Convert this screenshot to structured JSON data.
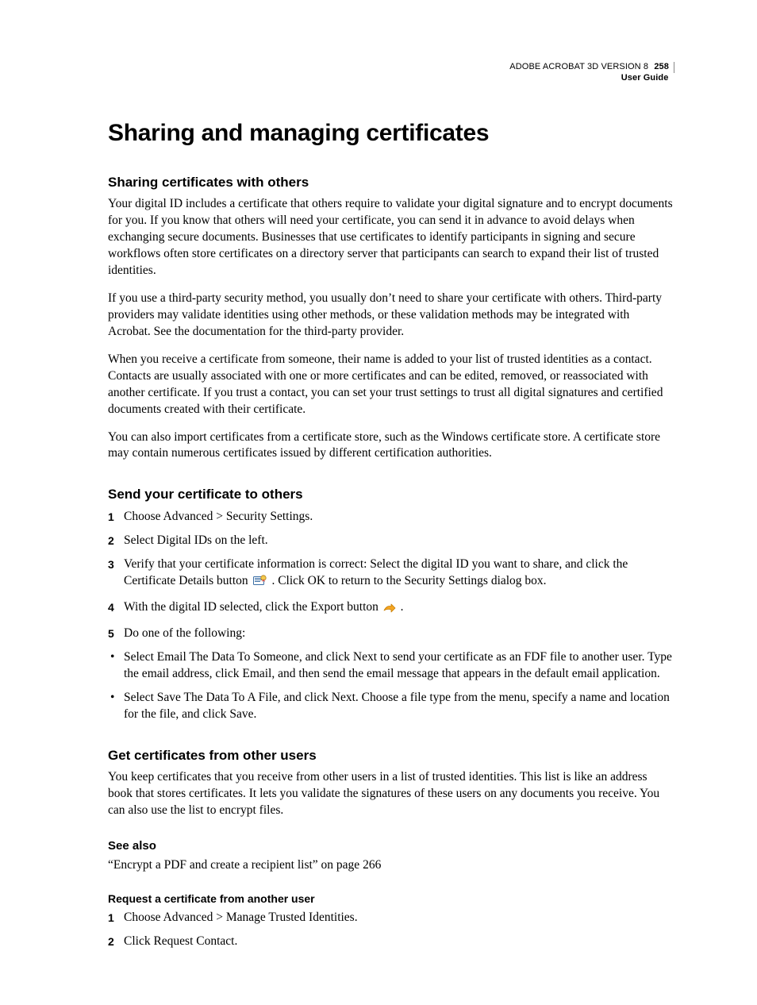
{
  "header": {
    "product": "ADOBE ACROBAT 3D VERSION 8",
    "page_number": "258",
    "doc_label": "User Guide"
  },
  "chapter_title": "Sharing and managing certificates",
  "section1": {
    "title": "Sharing certificates with others",
    "p1": "Your digital ID includes a certificate that others require to validate your digital signature and to encrypt documents for you. If you know that others will need your certificate, you can send it in advance to avoid delays when exchanging secure documents. Businesses that use certificates to identify participants in signing and secure workflows often store certificates on a directory server that participants can search to expand their list of trusted identities.",
    "p2": "If you use a third-party security method, you usually don’t need to share your certificate with others. Third-party providers may validate identities using other methods, or these validation methods may be integrated with Acrobat. See the documentation for the third-party provider.",
    "p3": "When you receive a certificate from someone, their name is added to your list of trusted identities as a contact. Contacts are usually associated with one or more certificates and can be edited, removed, or reassociated with another certificate. If you trust a contact, you can set your trust settings to trust all digital signatures and certified documents created with their certificate.",
    "p4": "You can also import certificates from a certificate store, such as the Windows certificate store. A certificate store may contain numerous certificates issued by different certification authorities."
  },
  "section2": {
    "title": "Send your certificate to others",
    "steps": {
      "s1": "Choose Advanced > Security Settings.",
      "s2": "Select Digital IDs on the left.",
      "s3a": "Verify that your certificate information is correct: Select the digital ID you want to share, and click the Certificate Details button ",
      "s3b": ". Click OK to return to the Security Settings dialog box.",
      "s4a": "With the digital ID selected, click the Export button ",
      "s4b": ".",
      "s5": "Do one of the following:"
    },
    "bullets": {
      "b1": "Select Email The Data To Someone, and click Next to send your certificate as an FDF file to another user. Type the email address, click Email, and then send the email message that appears in the default email application.",
      "b2": "Select Save The Data To A File, and click Next. Choose a file type from the menu, specify a name and location for the file, and click Save."
    }
  },
  "section3": {
    "title": "Get certificates from other users",
    "p1": "You keep certificates that you receive from other users in a list of trusted identities. This list is like an address book that stores certificates. It lets you validate the signatures of these users on any documents you receive. You can also use the list to encrypt files."
  },
  "see_also": {
    "title": "See also",
    "link_text": "“Encrypt a PDF and create a recipient list” on page 266"
  },
  "section4": {
    "title": "Request a certificate from another user",
    "steps": {
      "s1": "Choose Advanced > Manage Trusted Identities.",
      "s2": "Click Request Contact."
    }
  },
  "icons": {
    "certificate_details": "certificate-details-icon",
    "export": "export-arrow-icon"
  }
}
